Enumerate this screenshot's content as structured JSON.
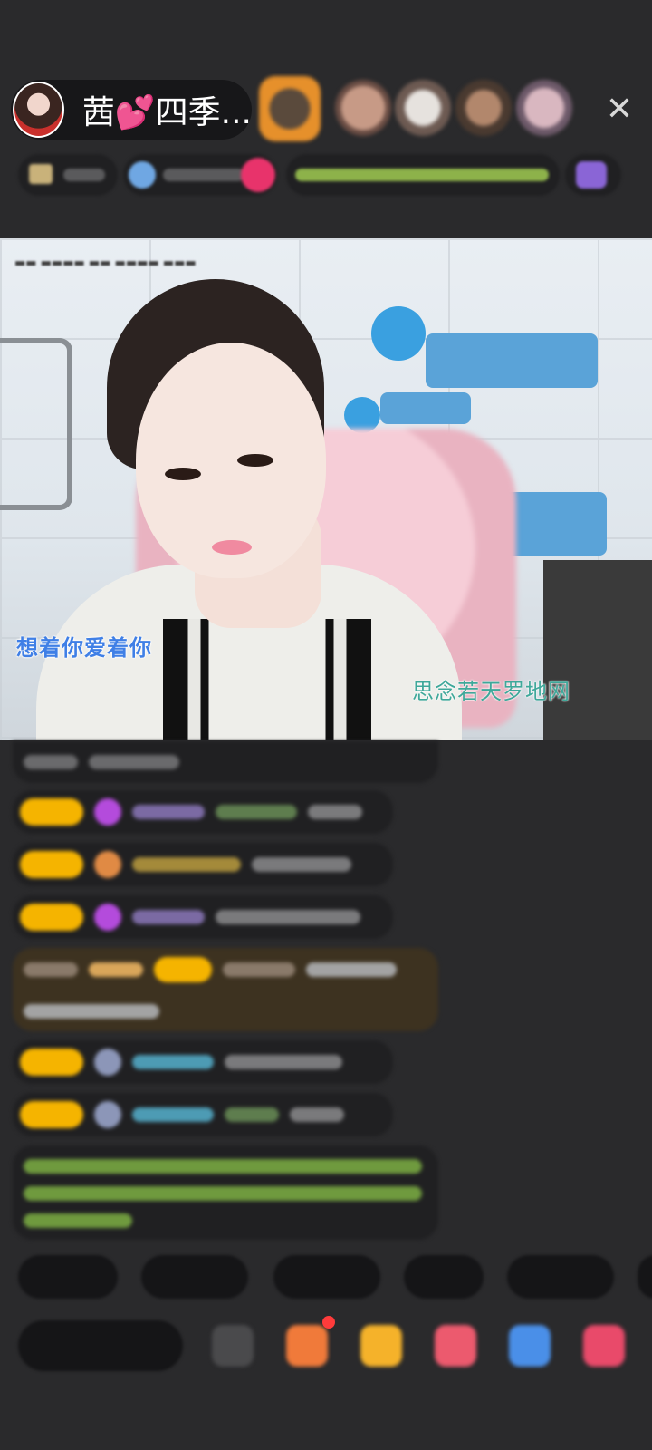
{
  "host": {
    "name": "茜💕四季..."
  },
  "close_label": "✕",
  "video": {
    "lyric_left": "想着你爱着你",
    "lyric_right": "思念若天罗地网"
  },
  "colors": {
    "background": "#2a2a2c",
    "level_badge": "#f5b400",
    "lyric_left": "#3f7fe6",
    "lyric_right": "#3fa89a"
  }
}
